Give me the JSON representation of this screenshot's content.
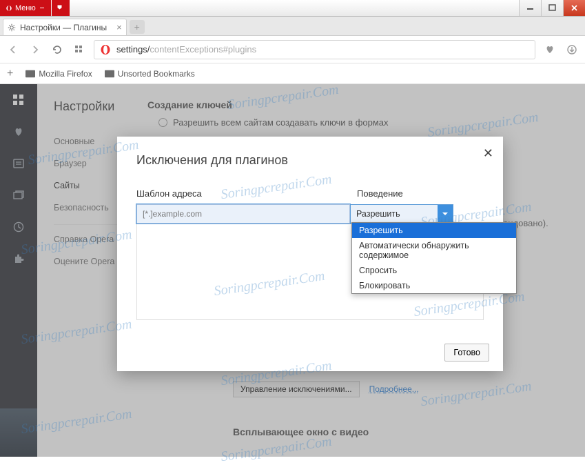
{
  "titlebar": {
    "menu_label": "Меню"
  },
  "tab": {
    "title": "Настройки — Плагины"
  },
  "address": {
    "text_main": "settings/",
    "text_dim": "contentExceptions#plugins"
  },
  "bookmarks": {
    "mozilla": "Mozilla Firefox",
    "unsorted": "Unsorted Bookmarks"
  },
  "settings": {
    "title": "Настройки",
    "items": [
      "Основные",
      "Браузер",
      "Сайты",
      "Безопасность"
    ],
    "help_items": [
      "Справка Opera",
      "Оцените Opera"
    ]
  },
  "main": {
    "section1_title": "Создание ключей",
    "radio_text": "Разрешить всем сайтам создавать ключи в формах",
    "rec_suffix": "омендовано).",
    "manage_btn": "Управление исключениями...",
    "more_link": "Подробнее...",
    "section2_title": "Всплывающее окно с видео"
  },
  "modal": {
    "title": "Исключения для плагинов",
    "col1_label": "Шаблон адреса",
    "col2_label": "Поведение",
    "placeholder": "[*.]example.com",
    "selected": "Разрешить",
    "done": "Готово"
  },
  "dropdown": {
    "options": [
      "Разрешить",
      "Автоматически обнаружить содержимое",
      "Спросить",
      "Блокировать"
    ]
  },
  "watermark": "Soringpcrepair.Com"
}
